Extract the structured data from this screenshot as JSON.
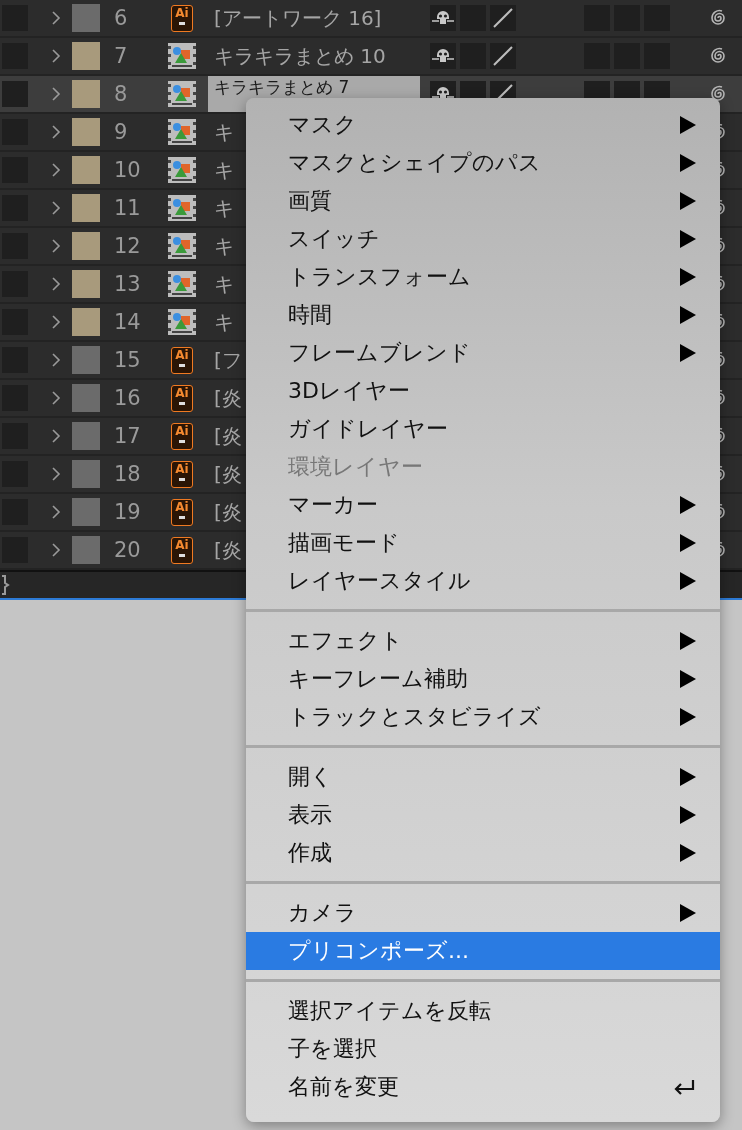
{
  "layers": [
    {
      "number": "6",
      "color": "#6b6b6b",
      "kind": "ai",
      "badge": "Ai",
      "name": "[アートワーク 16]",
      "selected": false
    },
    {
      "number": "7",
      "color": "#a89a7c",
      "kind": "footage",
      "name": "キラキラまとめ 10",
      "selected": false
    },
    {
      "number": "8",
      "color": "#a89a7c",
      "kind": "footage",
      "name": "キラキラまとめ 7",
      "selected": true
    },
    {
      "number": "9",
      "color": "#a89a7c",
      "kind": "footage",
      "name": "キ",
      "selected": false
    },
    {
      "number": "10",
      "color": "#a89a7c",
      "kind": "footage",
      "name": "キ",
      "selected": false
    },
    {
      "number": "11",
      "color": "#a89a7c",
      "kind": "footage",
      "name": "キ",
      "selected": false
    },
    {
      "number": "12",
      "color": "#a89a7c",
      "kind": "footage",
      "name": "キ",
      "selected": false
    },
    {
      "number": "13",
      "color": "#a89a7c",
      "kind": "footage",
      "name": "キ",
      "selected": false
    },
    {
      "number": "14",
      "color": "#a89a7c",
      "kind": "footage",
      "name": "キ",
      "selected": false
    },
    {
      "number": "15",
      "color": "#6b6b6b",
      "kind": "ai",
      "badge": "Ai",
      "name": "[フ",
      "selected": false
    },
    {
      "number": "16",
      "color": "#6b6b6b",
      "kind": "ai",
      "badge": "Ai",
      "name": "[炎",
      "selected": false
    },
    {
      "number": "17",
      "color": "#6b6b6b",
      "kind": "ai",
      "badge": "Ai",
      "name": "[炎",
      "selected": false
    },
    {
      "number": "18",
      "color": "#6b6b6b",
      "kind": "ai",
      "badge": "Ai",
      "name": "[炎",
      "selected": false
    },
    {
      "number": "19",
      "color": "#6b6b6b",
      "kind": "ai",
      "badge": "Ai",
      "name": "[炎",
      "selected": false
    },
    {
      "number": "20",
      "color": "#6b6b6b",
      "kind": "ai",
      "badge": "Ai",
      "name": "[炎",
      "selected": false
    }
  ],
  "context_menu": {
    "groups": [
      {
        "items": [
          {
            "label": "マスク",
            "submenu": true,
            "disabled": false,
            "selected": false,
            "return_icon": false
          },
          {
            "label": "マスクとシェイプのパス",
            "submenu": true,
            "disabled": false,
            "selected": false,
            "return_icon": false
          },
          {
            "label": "画質",
            "submenu": true,
            "disabled": false,
            "selected": false,
            "return_icon": false
          },
          {
            "label": "スイッチ",
            "submenu": true,
            "disabled": false,
            "selected": false,
            "return_icon": false
          },
          {
            "label": "トランスフォーム",
            "submenu": true,
            "disabled": false,
            "selected": false,
            "return_icon": false
          },
          {
            "label": "時間",
            "submenu": true,
            "disabled": false,
            "selected": false,
            "return_icon": false
          },
          {
            "label": "フレームブレンド",
            "submenu": true,
            "disabled": false,
            "selected": false,
            "return_icon": false
          },
          {
            "label": "3Dレイヤー",
            "submenu": false,
            "disabled": false,
            "selected": false,
            "return_icon": false
          },
          {
            "label": "ガイドレイヤー",
            "submenu": false,
            "disabled": false,
            "selected": false,
            "return_icon": false
          },
          {
            "label": "環境レイヤー",
            "submenu": false,
            "disabled": true,
            "selected": false,
            "return_icon": false
          },
          {
            "label": "マーカー",
            "submenu": true,
            "disabled": false,
            "selected": false,
            "return_icon": false
          },
          {
            "label": "描画モード",
            "submenu": true,
            "disabled": false,
            "selected": false,
            "return_icon": false
          },
          {
            "label": "レイヤースタイル",
            "submenu": true,
            "disabled": false,
            "selected": false,
            "return_icon": false
          }
        ]
      },
      {
        "items": [
          {
            "label": "エフェクト",
            "submenu": true,
            "disabled": false,
            "selected": false,
            "return_icon": false
          },
          {
            "label": "キーフレーム補助",
            "submenu": true,
            "disabled": false,
            "selected": false,
            "return_icon": false
          },
          {
            "label": "トラックとスタビライズ",
            "submenu": true,
            "disabled": false,
            "selected": false,
            "return_icon": false
          }
        ]
      },
      {
        "items": [
          {
            "label": "開く",
            "submenu": true,
            "disabled": false,
            "selected": false,
            "return_icon": false
          },
          {
            "label": "表示",
            "submenu": true,
            "disabled": false,
            "selected": false,
            "return_icon": false
          },
          {
            "label": "作成",
            "submenu": true,
            "disabled": false,
            "selected": false,
            "return_icon": false
          }
        ]
      },
      {
        "items": [
          {
            "label": "カメラ",
            "submenu": true,
            "disabled": false,
            "selected": false,
            "return_icon": false
          },
          {
            "label": "プリコンポーズ...",
            "submenu": false,
            "disabled": false,
            "selected": true,
            "return_icon": false
          }
        ]
      },
      {
        "items": [
          {
            "label": "選択アイテムを反転",
            "submenu": false,
            "disabled": false,
            "selected": false,
            "return_icon": false
          },
          {
            "label": "子を選択",
            "submenu": false,
            "disabled": false,
            "selected": false,
            "return_icon": false
          },
          {
            "label": "名前を変更",
            "submenu": false,
            "disabled": false,
            "selected": false,
            "return_icon": true
          }
        ]
      }
    ]
  }
}
